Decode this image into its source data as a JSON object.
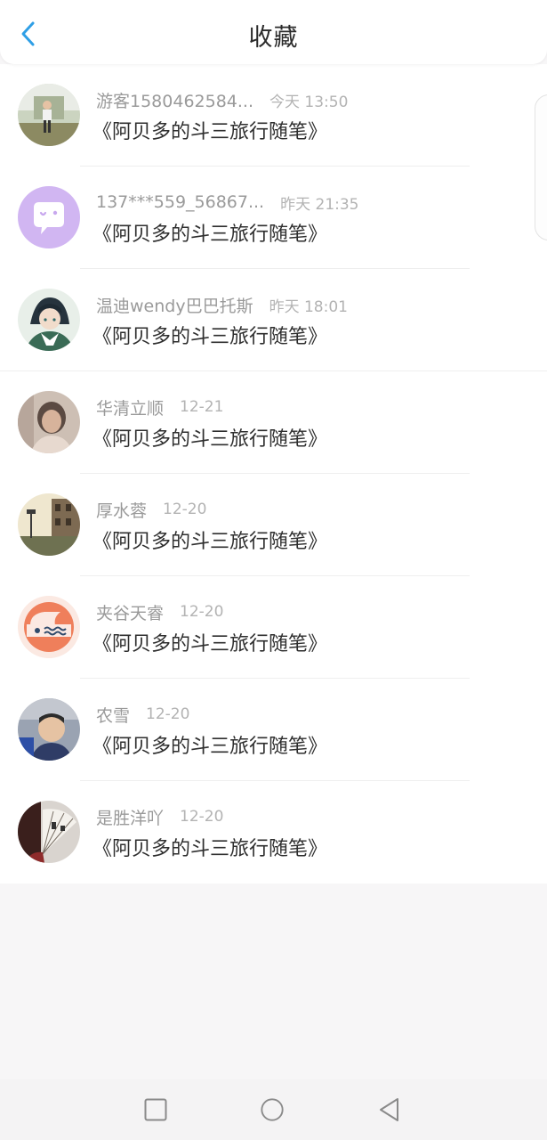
{
  "header": {
    "title": "收藏",
    "back_icon": "chevron-left-icon",
    "accent_color": "#2f9fe6"
  },
  "favorites": [
    {
      "username": "游客1580462584...",
      "time": "今天 13:50",
      "book": "《阿贝多的斗三旅行随笔》",
      "avatar": "child-photo-avatar"
    },
    {
      "username": "137***559_56867...",
      "time": "昨天 21:35",
      "book": "《阿贝多的斗三旅行随笔》",
      "avatar": "purple-chat-bubble-avatar"
    },
    {
      "username": "温迪wendy巴巴托斯",
      "time": "昨天 18:01",
      "book": "《阿贝多的斗三旅行随笔》",
      "avatar": "anime-character-avatar"
    },
    {
      "username": "华清立顺",
      "time": "12-21",
      "book": "《阿贝多的斗三旅行随笔》",
      "avatar": "blurred-portrait-avatar"
    },
    {
      "username": "厚水蓉",
      "time": "12-20",
      "book": "《阿贝多的斗三旅行随笔》",
      "avatar": "street-scene-avatar"
    },
    {
      "username": "夹谷天睿",
      "time": "12-20",
      "book": "《阿贝多的斗三旅行随笔》",
      "avatar": "orange-logo-avatar"
    },
    {
      "username": "农雪",
      "time": "12-20",
      "book": "《阿贝多的斗三旅行随笔》",
      "avatar": "boy-photo-avatar"
    },
    {
      "username": "是胜洋吖",
      "time": "12-20",
      "book": "《阿贝多的斗三旅行随笔》",
      "avatar": "fan-photo-avatar"
    }
  ],
  "navbar": {
    "recents_icon": "square-icon",
    "home_icon": "circle-icon",
    "back_icon": "triangle-back-icon"
  }
}
